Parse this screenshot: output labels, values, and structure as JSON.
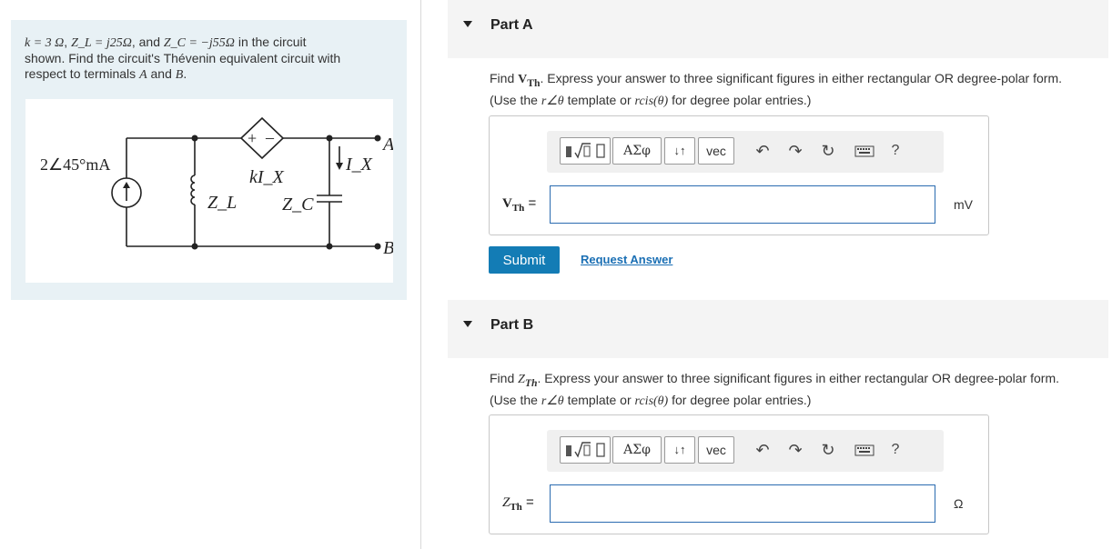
{
  "problem": {
    "k_eq": "k = 3 Ω",
    "zl_eq": "Z_L = j25Ω",
    "zc_eq": "Z_C = −j55Ω",
    "line1_tail": " in the circuit",
    "line2": "shown. Find the circuit's Thévenin equivalent circuit with",
    "line3_pre": "respect to terminals ",
    "term_a": "A",
    "and_word": " and ",
    "term_b": "B",
    "period": ".",
    "circuit": {
      "source_label": "2∠45°mA",
      "zl_label": "Z_L",
      "dep_label": "kI_X",
      "ix_label": "I_X",
      "zc_label": "Z_C",
      "terminal_a": "A",
      "terminal_b": "B"
    }
  },
  "part_a": {
    "title": "Part A",
    "prompt_pre": "Find ",
    "var": "V",
    "var_sub": "Th",
    "prompt_mid": ". Express your answer to three significant figures in either rectangular OR degree-polar form.",
    "prompt_line2_pre": "(Use the ",
    "template": "r∠θ",
    "prompt_line2_mid": " template or ",
    "rcis": "rcis(θ)",
    "prompt_line2_post": " for degree polar entries.)",
    "answer_label": "V",
    "answer_label_sub": "Th",
    "answer_eq": " =",
    "answer_value": "",
    "unit": "mV",
    "submit": "Submit",
    "request_answer": "Request Answer"
  },
  "part_b": {
    "title": "Part B",
    "prompt_pre": "Find ",
    "var": "Z",
    "var_sub": "Th",
    "prompt_mid": ". Express your answer to three significant figures in either rectangular OR degree-polar form.",
    "prompt_line2_pre": "(Use the ",
    "template": "r∠θ",
    "prompt_line2_mid": " template or ",
    "rcis": "rcis(θ)",
    "prompt_line2_post": " for degree polar entries.)",
    "answer_label": "Z",
    "answer_label_sub": "Th",
    "answer_eq": " =",
    "answer_value": "",
    "unit": "Ω"
  },
  "toolbar": {
    "greek": "ΑΣφ",
    "sort": "↓↑",
    "vec": "vec",
    "help": "?"
  }
}
